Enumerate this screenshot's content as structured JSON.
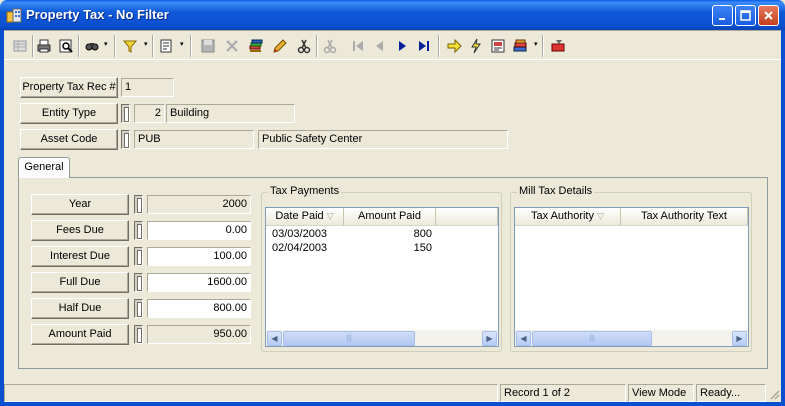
{
  "window": {
    "title": "Property Tax - No Filter"
  },
  "toolbar": {
    "icons": [
      "grid-icon",
      "print-icon",
      "preview-icon",
      "find-icon",
      "filter-icon",
      "report-icon",
      "save-icon",
      "delete-icon",
      "new-record-icon",
      "edit-icon",
      "undo-icon",
      "cut-icon",
      "first-record-icon",
      "prev-record-icon",
      "next-record-icon",
      "last-record-icon",
      "jump-icon",
      "lightning-icon",
      "lookup-icon",
      "books-icon",
      "exit-icon"
    ]
  },
  "header": {
    "property_tax_rec": {
      "label": "Property Tax Rec #",
      "value": "1"
    },
    "entity_type": {
      "label": "Entity Type",
      "code": "2",
      "desc": "Building"
    },
    "asset_code": {
      "label": "Asset Code",
      "code": "PUB",
      "desc": "Public Safety Center"
    }
  },
  "tabs": [
    {
      "label": "General"
    }
  ],
  "general": {
    "fields": [
      {
        "label": "Year",
        "value": "2000"
      },
      {
        "label": "Fees Due",
        "value": "0.00"
      },
      {
        "label": "Interest Due",
        "value": "100.00"
      },
      {
        "label": "Full Due",
        "value": "1600.00"
      },
      {
        "label": "Half Due",
        "value": "800.00"
      },
      {
        "label": "Amount Paid",
        "value": "950.00"
      }
    ],
    "tax_payments": {
      "title": "Tax Payments",
      "columns": [
        "Date Paid",
        "Amount Paid"
      ],
      "rows": [
        {
          "date": "03/03/2003",
          "amount": "800"
        },
        {
          "date": "02/04/2003",
          "amount": "150"
        }
      ]
    },
    "mill_tax": {
      "title": "Mill Tax Details",
      "columns": [
        "Tax Authority",
        "Tax Authority Text"
      ]
    }
  },
  "status": {
    "record": "Record 1 of 2",
    "mode": "View Mode",
    "state": "Ready..."
  }
}
